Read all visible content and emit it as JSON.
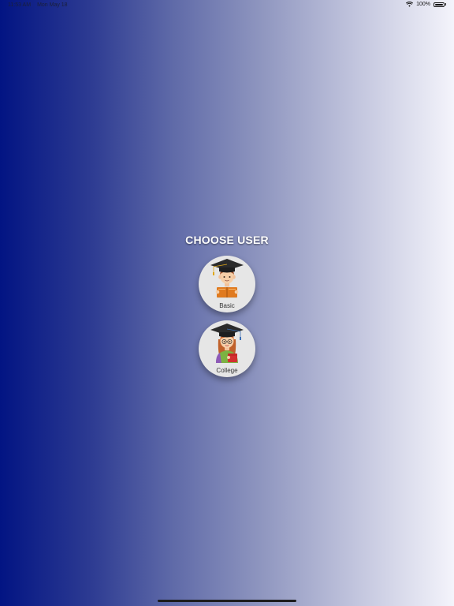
{
  "status_bar": {
    "time": "11:53 AM",
    "date": "Mon May 18",
    "battery_text": "100%",
    "battery_level": 1.0,
    "wifi_icon": "wifi-icon",
    "battery_icon": "battery-icon"
  },
  "chooser": {
    "title": "CHOOSE USER",
    "options": [
      {
        "label": "Basic",
        "icon": "student-boy-graduate-icon"
      },
      {
        "label": "College",
        "icon": "student-girl-graduate-icon"
      }
    ]
  },
  "colors": {
    "gradient_start": "#021483",
    "gradient_end": "#f4f4fb",
    "title_text": "#ffffff",
    "card_background": "#e6e6e6"
  }
}
